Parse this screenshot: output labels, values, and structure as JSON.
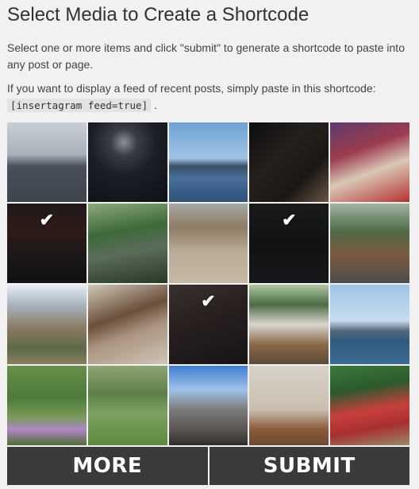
{
  "header": {
    "title": "Select Media to Create a Shortcode",
    "instructions": "Select one or more items and click \"submit\" to generate a shortcode to paste into any post or page.",
    "feed_text": "If you want to display a feed of recent posts, simply paste in this shortcode:",
    "shortcode": "[insertagram feed=true]",
    "feed_suffix": "."
  },
  "media": {
    "check_glyph": "✔",
    "items": [
      {
        "selected": false
      },
      {
        "selected": false
      },
      {
        "selected": false
      },
      {
        "selected": false
      },
      {
        "selected": false
      },
      {
        "selected": true
      },
      {
        "selected": false
      },
      {
        "selected": false
      },
      {
        "selected": true
      },
      {
        "selected": false
      },
      {
        "selected": false
      },
      {
        "selected": false
      },
      {
        "selected": true
      },
      {
        "selected": false
      },
      {
        "selected": false
      },
      {
        "selected": false
      },
      {
        "selected": false
      },
      {
        "selected": false
      },
      {
        "selected": false
      },
      {
        "selected": false
      }
    ]
  },
  "buttons": {
    "more_label": "MORE",
    "submit_label": "SUBMIT"
  }
}
